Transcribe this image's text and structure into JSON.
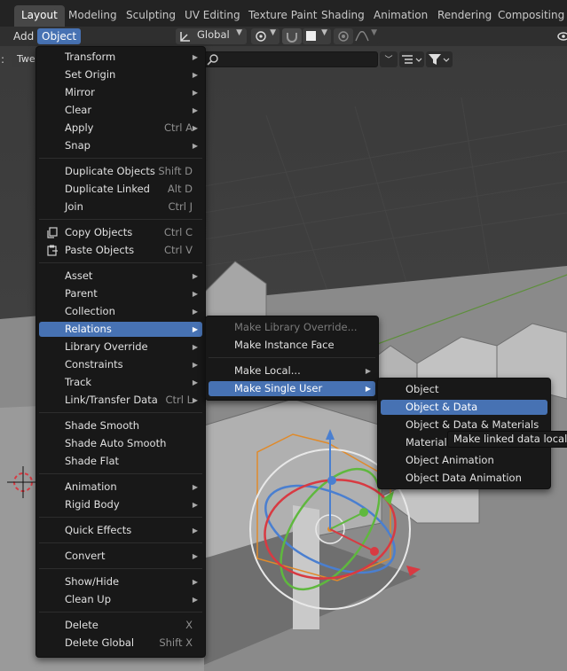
{
  "workspaces": [
    "Layout",
    "Modeling",
    "Sculpting",
    "UV Editing",
    "Texture Paint",
    "Shading",
    "Animation",
    "Rendering",
    "Compositing"
  ],
  "header": {
    "add_label": "Add",
    "object_label": "Object",
    "orientation_label": "Global",
    "side_label": "Twe",
    "edge_mark": ":"
  },
  "object_menu": [
    {
      "label": "Transform",
      "shortcut": "",
      "submenu": true
    },
    {
      "label": "Set Origin",
      "shortcut": "",
      "submenu": true
    },
    {
      "label": "Mirror",
      "shortcut": "",
      "submenu": true
    },
    {
      "label": "Clear",
      "shortcut": "",
      "submenu": true
    },
    {
      "label": "Apply",
      "shortcut": "Ctrl A",
      "submenu": true
    },
    {
      "label": "Snap",
      "shortcut": "",
      "submenu": true
    },
    {
      "label": "Duplicate Objects",
      "shortcut": "Shift D",
      "submenu": false
    },
    {
      "label": "Duplicate Linked",
      "shortcut": "Alt D",
      "submenu": false
    },
    {
      "label": "Join",
      "shortcut": "Ctrl J",
      "submenu": false
    },
    {
      "label": "Copy Objects",
      "shortcut": "Ctrl C",
      "submenu": false,
      "icon": "copy-icon"
    },
    {
      "label": "Paste Objects",
      "shortcut": "Ctrl V",
      "submenu": false,
      "icon": "paste-icon"
    },
    {
      "label": "Asset",
      "shortcut": "",
      "submenu": true
    },
    {
      "label": "Parent",
      "shortcut": "",
      "submenu": true
    },
    {
      "label": "Collection",
      "shortcut": "",
      "submenu": true
    },
    {
      "label": "Relations",
      "shortcut": "",
      "submenu": true,
      "highlighted": true
    },
    {
      "label": "Library Override",
      "shortcut": "",
      "submenu": true
    },
    {
      "label": "Constraints",
      "shortcut": "",
      "submenu": true
    },
    {
      "label": "Track",
      "shortcut": "",
      "submenu": true
    },
    {
      "label": "Link/Transfer Data",
      "shortcut": "Ctrl L",
      "submenu": true
    },
    {
      "label": "Shade Smooth",
      "shortcut": "",
      "submenu": false
    },
    {
      "label": "Shade Auto Smooth",
      "shortcut": "",
      "submenu": false
    },
    {
      "label": "Shade Flat",
      "shortcut": "",
      "submenu": false
    },
    {
      "label": "Animation",
      "shortcut": "",
      "submenu": true
    },
    {
      "label": "Rigid Body",
      "shortcut": "",
      "submenu": true
    },
    {
      "label": "Quick Effects",
      "shortcut": "",
      "submenu": true
    },
    {
      "label": "Convert",
      "shortcut": "",
      "submenu": true
    },
    {
      "label": "Show/Hide",
      "shortcut": "",
      "submenu": true
    },
    {
      "label": "Clean Up",
      "shortcut": "",
      "submenu": true
    },
    {
      "label": "Delete",
      "shortcut": "X",
      "submenu": false
    },
    {
      "label": "Delete Global",
      "shortcut": "Shift X",
      "submenu": false
    }
  ],
  "relations_menu": [
    {
      "label": "Make Library Override...",
      "disabled": true
    },
    {
      "label": "Make Instance Face"
    },
    {
      "label": "Make Local...",
      "submenu": true
    },
    {
      "label": "Make Single User",
      "submenu": true,
      "highlighted": true
    }
  ],
  "single_user_menu": [
    {
      "label": "Object"
    },
    {
      "label": "Object & Data",
      "highlighted": true
    },
    {
      "label": "Object & Data & Materials"
    },
    {
      "label": "Materials"
    },
    {
      "label": "Object Animation"
    },
    {
      "label": "Object Data Animation"
    }
  ],
  "tooltip": "Make linked data local to each object",
  "colors": {
    "highlight": "#4772b3",
    "menu_bg": "#181818",
    "topbar": "#232323"
  }
}
